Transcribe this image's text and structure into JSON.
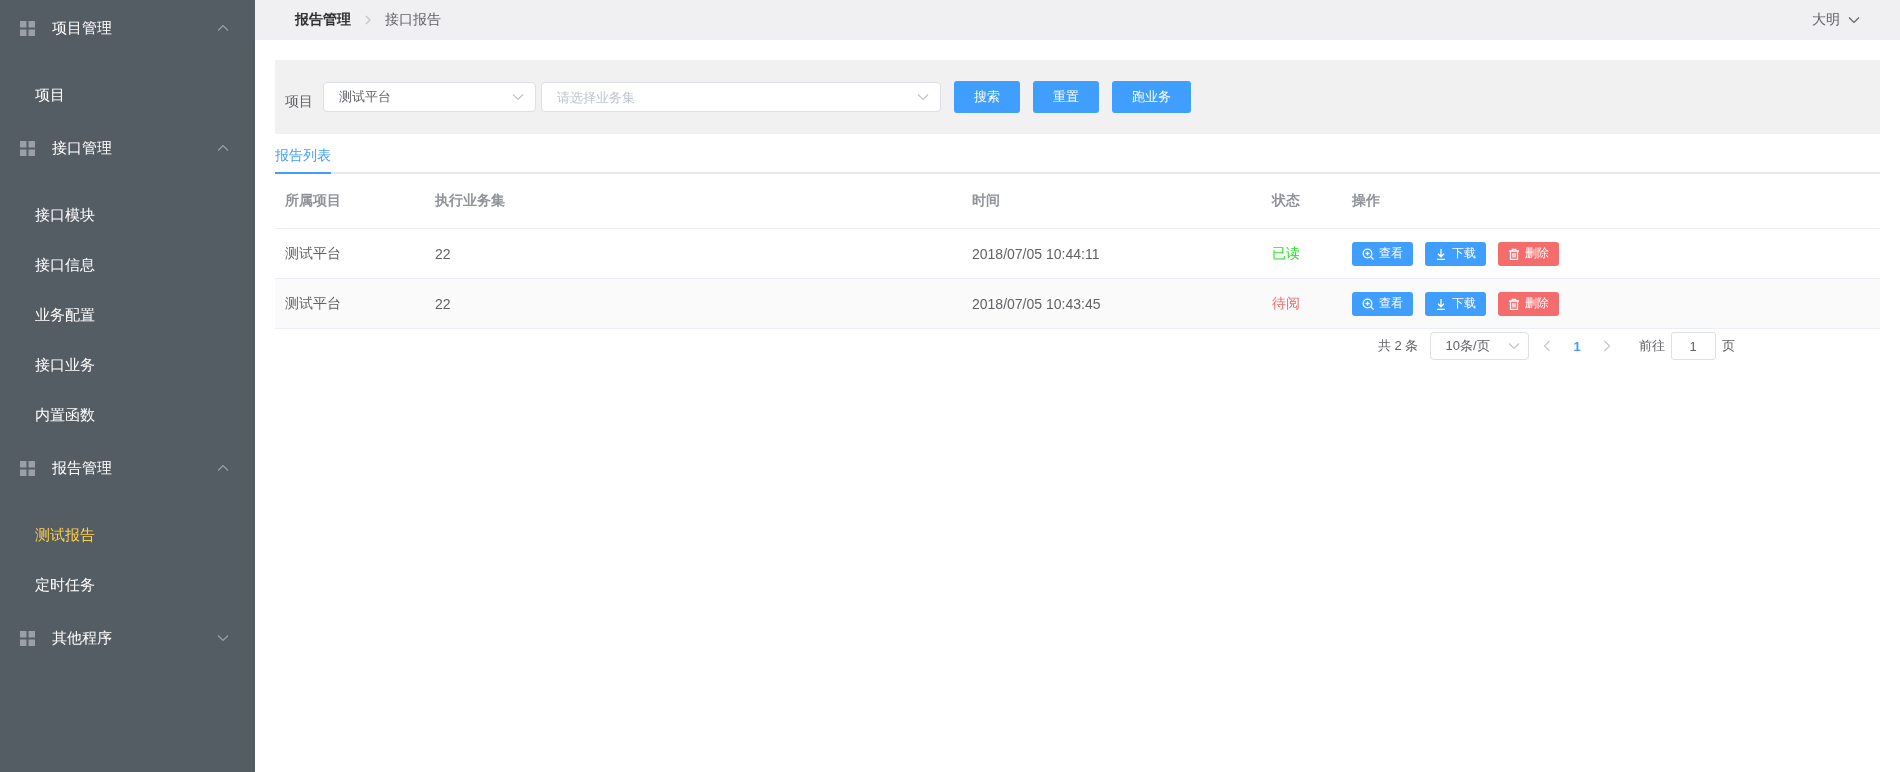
{
  "sidebar": {
    "groups": [
      {
        "title": "项目管理",
        "expanded": true,
        "items": [
          {
            "label": "项目",
            "selected": false
          }
        ]
      },
      {
        "title": "接口管理",
        "expanded": true,
        "items": [
          {
            "label": "接口模块",
            "selected": false
          },
          {
            "label": "接口信息",
            "selected": false
          },
          {
            "label": "业务配置",
            "selected": false
          },
          {
            "label": "接口业务",
            "selected": false
          },
          {
            "label": "内置函数",
            "selected": false
          }
        ]
      },
      {
        "title": "报告管理",
        "expanded": true,
        "items": [
          {
            "label": "测试报告",
            "selected": true
          },
          {
            "label": "定时任务",
            "selected": false
          }
        ]
      },
      {
        "title": "其他程序",
        "expanded": false
      }
    ]
  },
  "header": {
    "breadcrumb": [
      "报告管理",
      "接口报告"
    ],
    "user": "大明"
  },
  "filter": {
    "label": "项目",
    "project_select": {
      "value": "测试平台"
    },
    "suite_select": {
      "placeholder": "请选择业务集"
    },
    "buttons": [
      "搜索",
      "重置",
      "跑业务"
    ]
  },
  "tabs": [
    {
      "label": "报告列表",
      "selected": true
    }
  ],
  "table": {
    "columns": [
      "所属项目",
      "执行业务集",
      "时间",
      "状态",
      "操作"
    ],
    "rows": [
      {
        "project": "测试平台",
        "suite": "22",
        "time": "2018/07/05 10:44:11",
        "status": "已读",
        "color": "#1ee61e",
        "actions": [
          {
            "kind": "view",
            "label": "查看"
          },
          {
            "kind": "download",
            "label": "下载"
          },
          {
            "kind": "delete",
            "label": "删除"
          }
        ]
      },
      {
        "project": "测试平台",
        "suite": "22",
        "time": "2018/07/05 10:43:45",
        "status": "待阅",
        "color": "#f56c6c",
        "actions": [
          {
            "kind": "view",
            "label": "查看"
          },
          {
            "kind": "download",
            "label": "下载"
          },
          {
            "kind": "delete",
            "label": "删除"
          }
        ]
      }
    ]
  },
  "pagination": {
    "total": "共 2 条",
    "page_size": "10条/页",
    "pages": [
      {
        "label": "1",
        "selected": true
      }
    ],
    "goto_label": "前往",
    "goto_value": "1",
    "page_unit": "页"
  }
}
